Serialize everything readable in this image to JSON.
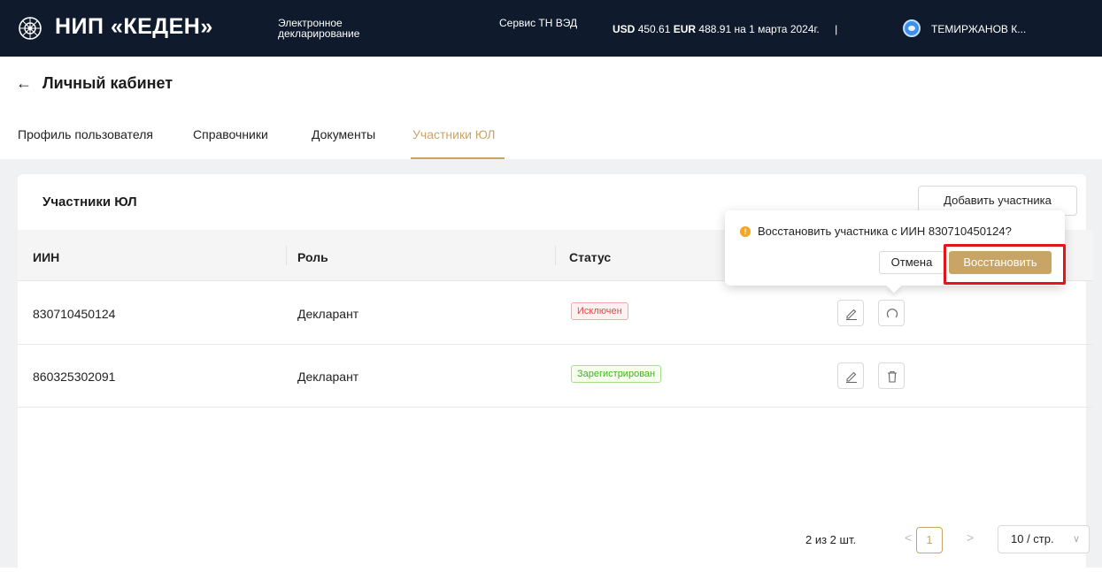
{
  "topbar": {
    "logo_text": "НИП «КЕДЕН»",
    "nav_electronic": "Электронное декларирование",
    "nav_service": "Сервис ТН ВЭД",
    "usd_label": "USD",
    "usd_value": "450.61",
    "eur_label": "EUR",
    "eur_value": "488.91",
    "rate_date": "на 1 марта 2024г.",
    "separator": "|",
    "user_name": "ТЕМИРЖАНОВ К..."
  },
  "header": {
    "back_icon": "arrow-left-icon",
    "title": "Личный кабинет"
  },
  "tabs": [
    {
      "label": "Профиль пользователя",
      "active": false
    },
    {
      "label": "Справочники",
      "active": false
    },
    {
      "label": "Документы",
      "active": false
    },
    {
      "label": "Участники ЮЛ",
      "active": true
    }
  ],
  "card": {
    "title": "Участники ЮЛ",
    "add_button": "Добавить участника"
  },
  "table": {
    "columns": [
      "ИИН",
      "Роль",
      "Статус"
    ],
    "rows": [
      {
        "iin": "830710450124",
        "role": "Декларант",
        "status": "Исключен",
        "status_type": "excluded",
        "actions": [
          "edit-icon",
          "restore-icon"
        ]
      },
      {
        "iin": "860325302091",
        "role": "Декларант",
        "status": "Зарегистрирован",
        "status_type": "registered",
        "actions": [
          "edit-icon",
          "delete-icon"
        ]
      }
    ]
  },
  "popconfirm": {
    "icon": "exclamation-icon",
    "message": "Восстановить участника с ИИН 830710450124?",
    "cancel": "Отмена",
    "confirm": "Восстановить"
  },
  "pagination": {
    "total": "2 из 2 шт.",
    "prev": "<",
    "current_page": "1",
    "next": ">",
    "page_size": "10 / стр."
  },
  "colors": {
    "accent": "#c9a467",
    "topbar": "#0f1a2c",
    "highlight": "#e3141b"
  }
}
